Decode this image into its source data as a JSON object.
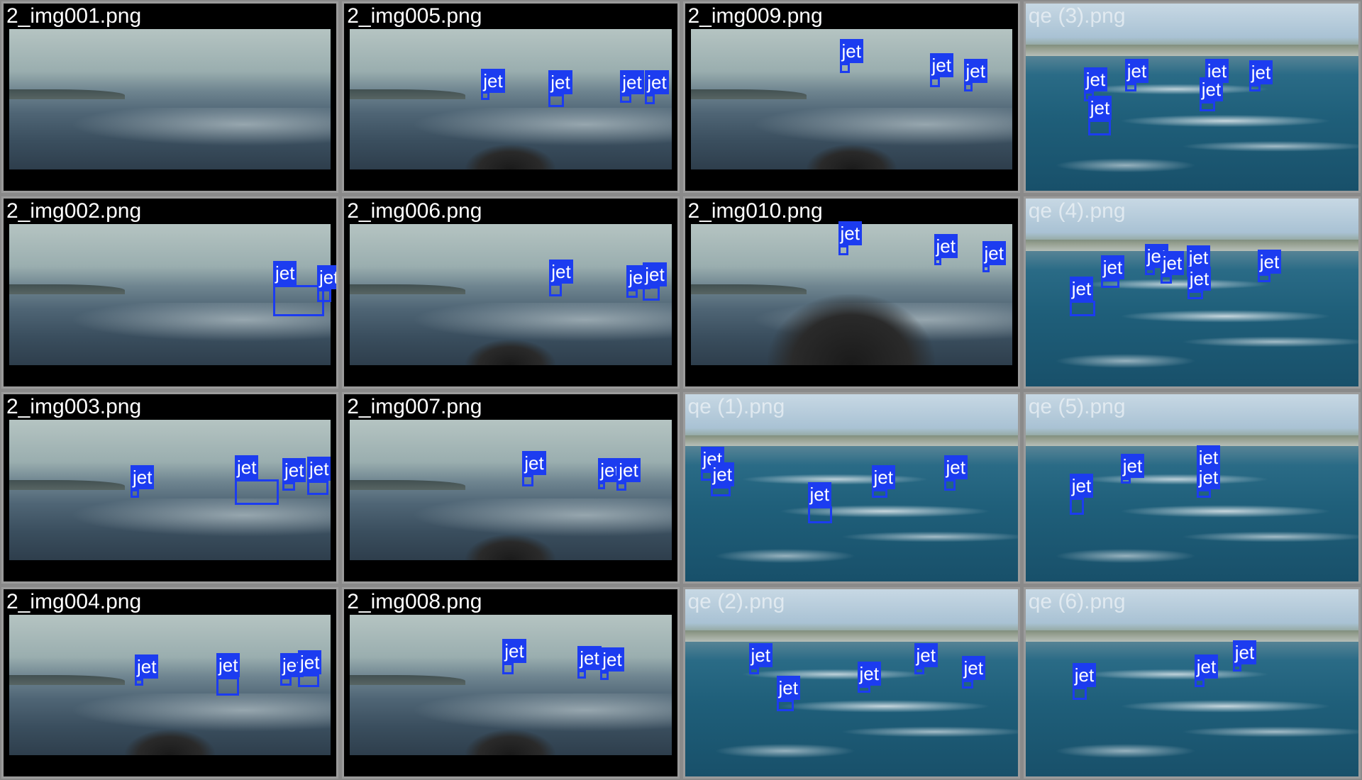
{
  "detection_label": "jet",
  "box_color": "#1c3cf0",
  "tiles": [
    {
      "name": "2_img001.png",
      "kind": "pov"
    },
    {
      "name": "2_img005.png",
      "kind": "pov"
    },
    {
      "name": "2_img009.png",
      "kind": "pov"
    },
    {
      "name": "qe (3).png",
      "kind": "aerial"
    },
    {
      "name": "2_img002.png",
      "kind": "pov"
    },
    {
      "name": "2_img006.png",
      "kind": "pov"
    },
    {
      "name": "2_img010.png",
      "kind": "pov"
    },
    {
      "name": "qe (4).png",
      "kind": "aerial"
    },
    {
      "name": "2_img003.png",
      "kind": "pov"
    },
    {
      "name": "2_img007.png",
      "kind": "pov"
    },
    {
      "name": "qe (1).png",
      "kind": "aerial"
    },
    {
      "name": "qe (5).png",
      "kind": "aerial"
    },
    {
      "name": "2_img004.png",
      "kind": "pov"
    },
    {
      "name": "2_img008.png",
      "kind": "pov"
    },
    {
      "name": "qe (2).png",
      "kind": "aerial"
    },
    {
      "name": "qe (6).png",
      "kind": "aerial"
    }
  ]
}
